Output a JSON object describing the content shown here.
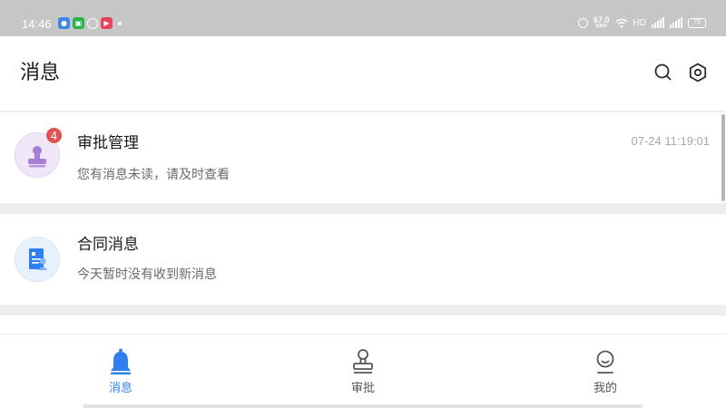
{
  "status_bar": {
    "time": "14:46",
    "network_speed": "67.0",
    "network_speed_unit": "KB/S",
    "hd_label": "HD",
    "battery": "79"
  },
  "header": {
    "title": "消息"
  },
  "messages": [
    {
      "title": "审批管理",
      "subtitle": "您有消息未读，请及时查看",
      "time": "07-24 11:19:01",
      "badge": "4",
      "icon": "stamp-icon"
    },
    {
      "title": "合同消息",
      "subtitle": "今天暂时没有收到新消息",
      "icon": "contract-icon"
    }
  ],
  "bottom_nav": [
    {
      "label": "消息",
      "icon": "bell-icon",
      "active": true
    },
    {
      "label": "审批",
      "icon": "stamp-icon",
      "active": false
    },
    {
      "label": "我的",
      "icon": "user-icon",
      "active": false
    }
  ],
  "colors": {
    "accent": "#2f7ff0",
    "badge": "#e05150",
    "approval_avatar_bg": "#efe6f8",
    "approval_icon": "#a57ed6",
    "contract_avatar_bg": "#e7f1fb",
    "contract_icon": "#2f7ff0",
    "status_bar_bg": "#c6c6c6"
  }
}
